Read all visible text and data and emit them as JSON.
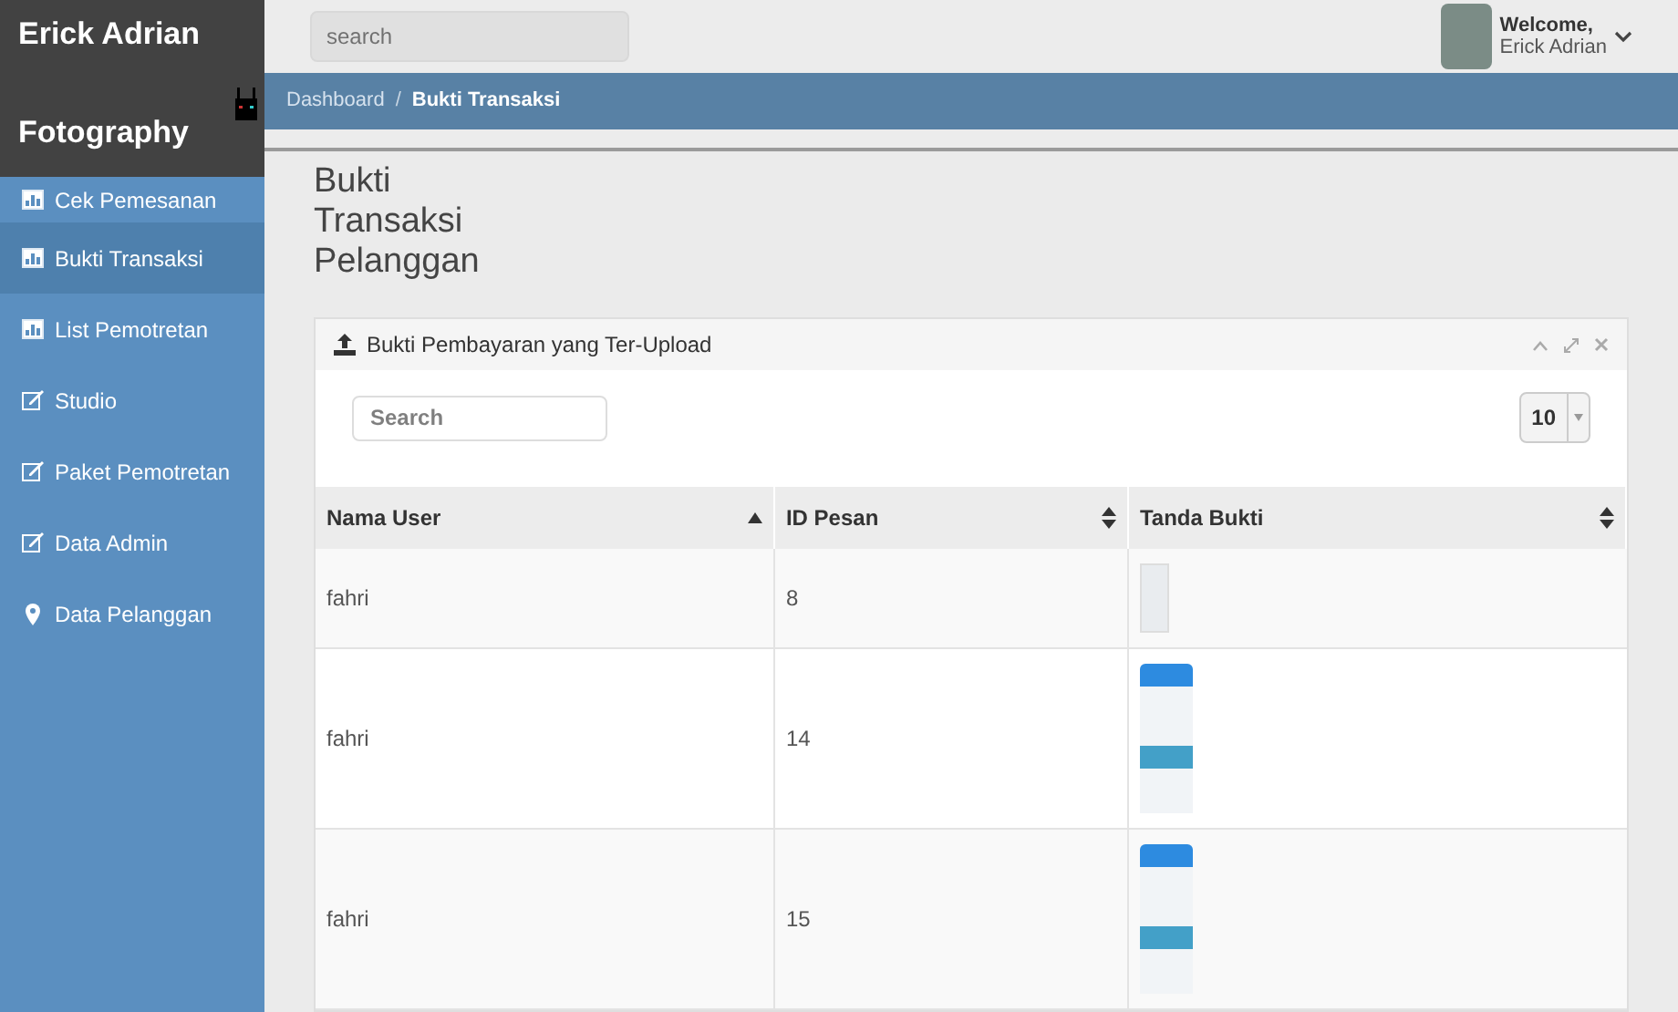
{
  "brand": {
    "line1": "Erick Adrian",
    "line2": "Fotography"
  },
  "sidebar": {
    "items": [
      {
        "label": "Cek Pemesanan",
        "kind": "chart",
        "selected": false
      },
      {
        "label": "Bukti Transaksi",
        "kind": "chart",
        "selected": true
      },
      {
        "label": "List Pemotretan",
        "kind": "chart",
        "selected": false
      },
      {
        "label": "Studio",
        "kind": "edit",
        "selected": false
      },
      {
        "label": "Paket Pemotretan",
        "kind": "edit",
        "selected": false
      },
      {
        "label": "Data Admin",
        "kind": "edit",
        "selected": false
      },
      {
        "label": "Data Pelanggan",
        "kind": "pin",
        "selected": false
      }
    ]
  },
  "topbar": {
    "search_placeholder": "search",
    "welcome": "Welcome,",
    "user": "Erick Adrian"
  },
  "breadcrumb": {
    "separator": "/",
    "items": [
      {
        "label": "Dashboard",
        "current": false
      },
      {
        "label": "Bukti Transaksi",
        "current": true
      }
    ]
  },
  "page_title": [
    "Bukti",
    "Transaksi",
    "Pelanggan"
  ],
  "panel": {
    "title": "Bukti Pembayaran yang Ter-Upload",
    "search_placeholder": "Search",
    "page_size": "10",
    "table": {
      "columns": [
        {
          "label": "Nama User",
          "kind": "asc"
        },
        {
          "label": "ID Pesan",
          "kind": "unsorted"
        },
        {
          "label": "Tanda Bukti",
          "kind": "unsorted"
        }
      ],
      "rows": [
        {
          "user": "fahri",
          "id": "8",
          "kind": "document"
        },
        {
          "user": "fahri",
          "id": "14",
          "kind": "phone"
        },
        {
          "user": "fahri",
          "id": "15",
          "kind": "phone"
        }
      ]
    }
  }
}
